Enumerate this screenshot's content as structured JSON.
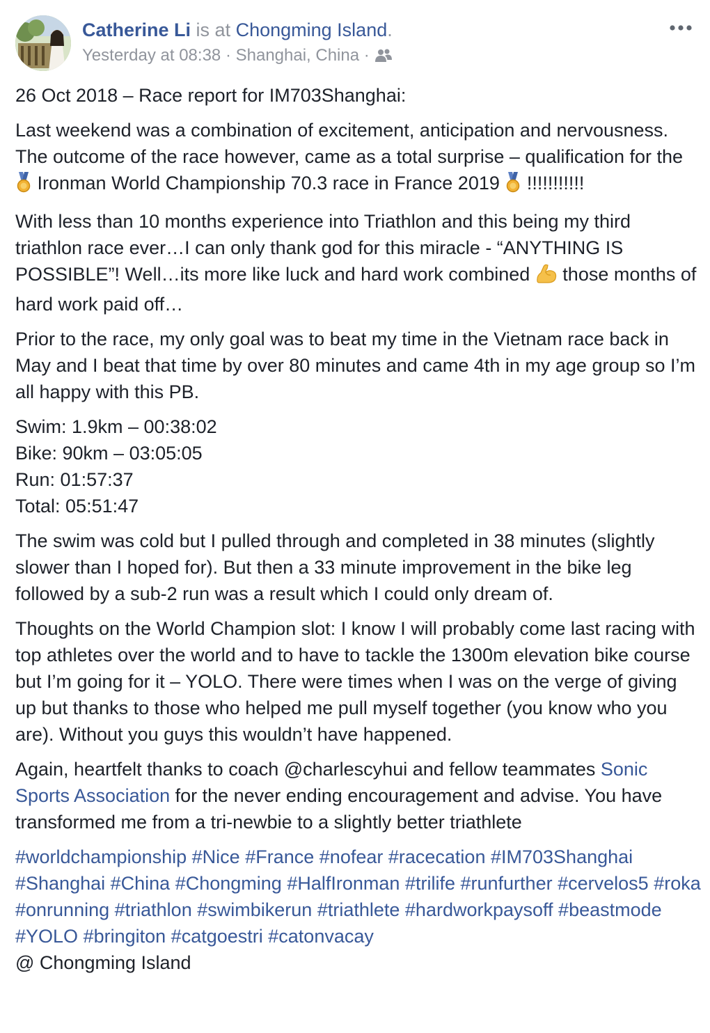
{
  "post": {
    "author": "Catherine Li",
    "is_at_text": "is at",
    "place": "Chongming Island",
    "place_period": ".",
    "timestamp": "Yesterday at 08:38",
    "meta_separator": "·",
    "location": "Shanghai, China",
    "audience_icon": "friends-icon",
    "more_icon": "ellipsis-icon"
  },
  "body": {
    "date_line": "26 Oct 2018 – Race report for IM703Shanghai:",
    "para1_a": "Last weekend was a combination of excitement, anticipation and nervousness. The outcome of the race however, came as a total surprise – qualification for the ",
    "para1_b": "Ironman World Championship 70.3 race in France 2019 ",
    "para1_c": "!!!!!!!!!!!",
    "para2_a": "With less than 10 months experience into Triathlon and this being my third triathlon race ever…I can only thank god for this miracle - “ANYTHING IS POSSIBLE”! Well…its more like luck and hard work combined ",
    "para2_b": " those months of hard work paid off…",
    "para3": "Prior to the race, my only goal was to beat my time in the Vietnam race back in May and I beat that time by over 80 minutes and came 4th in my age group so I’m all happy with this PB.",
    "stats": [
      "Swim: 1.9km – 00:38:02",
      "Bike: 90km – 03:05:05",
      "Run: 01:57:37",
      "Total: 05:51:47"
    ],
    "para4": "The swim was cold but I pulled through and completed in 38 minutes (slightly slower than I hoped for). But then a 33 minute improvement in the bike leg followed by a sub-2 run was a result which I could only dream of.",
    "para5": "Thoughts on the World Champion slot: I know I will probably come last racing with top athletes over the world and to have to tackle the 1300m elevation bike course but I’m going for it – YOLO. There were times when I was on the verge of giving up but thanks to those who helped me pull myself together (you know who you are). Without you guys this wouldn’t have happened.",
    "para6_a": "Again, heartfelt thanks to coach @charlescyhui and fellow teammates ",
    "para6_link": "Sonic Sports Association",
    "para6_b": " for the never ending encouragement and advise. You have transformed me from a tri-newbie to a slightly better triathlete",
    "hashtags": [
      "#worldchampionship",
      "#Nice",
      "#France",
      "#nofear",
      "#racecation",
      "#IM703Shanghai",
      "#Shanghai",
      "#China",
      "#Chongming",
      "#HalfIronman",
      "#trilife",
      "#runfurther",
      "#cervelos5",
      "#roka",
      "#onrunning",
      "#triathlon",
      "#swimbikerun",
      "#triathlete",
      "#hardworkpaysoff",
      "#beastmode",
      "#YOLO",
      "#bringiton",
      "#catgoestri",
      "#catonvacay"
    ],
    "checkin_line": "@ Chongming Island",
    "emoji": {
      "medal": "medal-icon",
      "muscle": "flexed-biceps-icon"
    }
  },
  "colors": {
    "link": "#385898",
    "meta": "#90949c",
    "text": "#1d2129",
    "medal_gold": "#f2b233",
    "medal_ribbon": "#5b7fc4",
    "muscle": "#f5c04a"
  }
}
